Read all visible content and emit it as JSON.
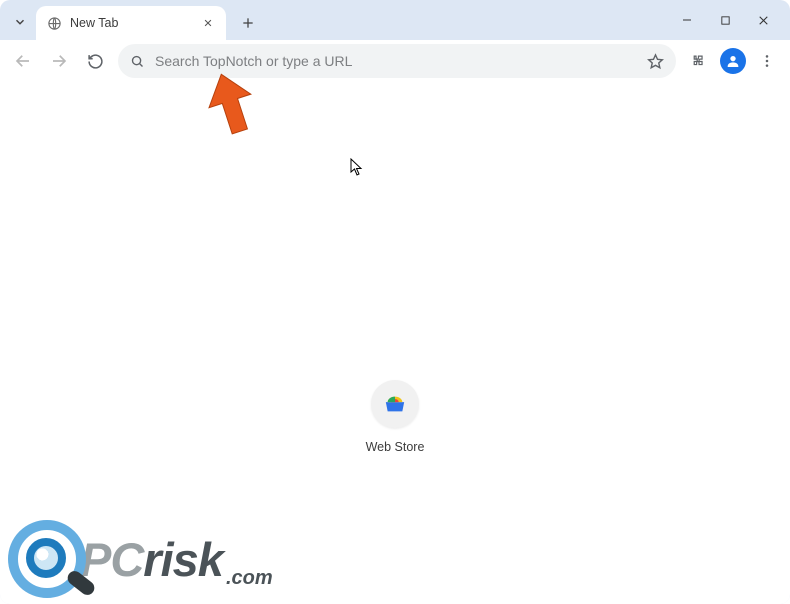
{
  "tab": {
    "title": "New Tab"
  },
  "omnibox": {
    "placeholder": "Search TopNotch or type a URL"
  },
  "shortcut": {
    "label": "Web Store"
  },
  "watermark": {
    "part1": "PC",
    "part2": "risk",
    "tld": ".com"
  },
  "icon_names": {
    "tab_dropdown": "chevron-down-icon",
    "favicon": "globe-icon",
    "close": "close-icon",
    "newtab": "plus-icon",
    "minimize": "minimize-icon",
    "maximize": "maximize-icon",
    "win_close": "close-icon",
    "back": "arrow-left-icon",
    "forward": "arrow-right-icon",
    "reload": "reload-icon",
    "search": "search-icon",
    "bookmark": "star-icon",
    "extensions": "puzzle-icon",
    "profile": "person-icon",
    "menu": "dots-vertical-icon",
    "webstore": "webstore-icon",
    "cursor": "cursor-icon",
    "arrow_annot": "arrow-up-left-icon"
  }
}
